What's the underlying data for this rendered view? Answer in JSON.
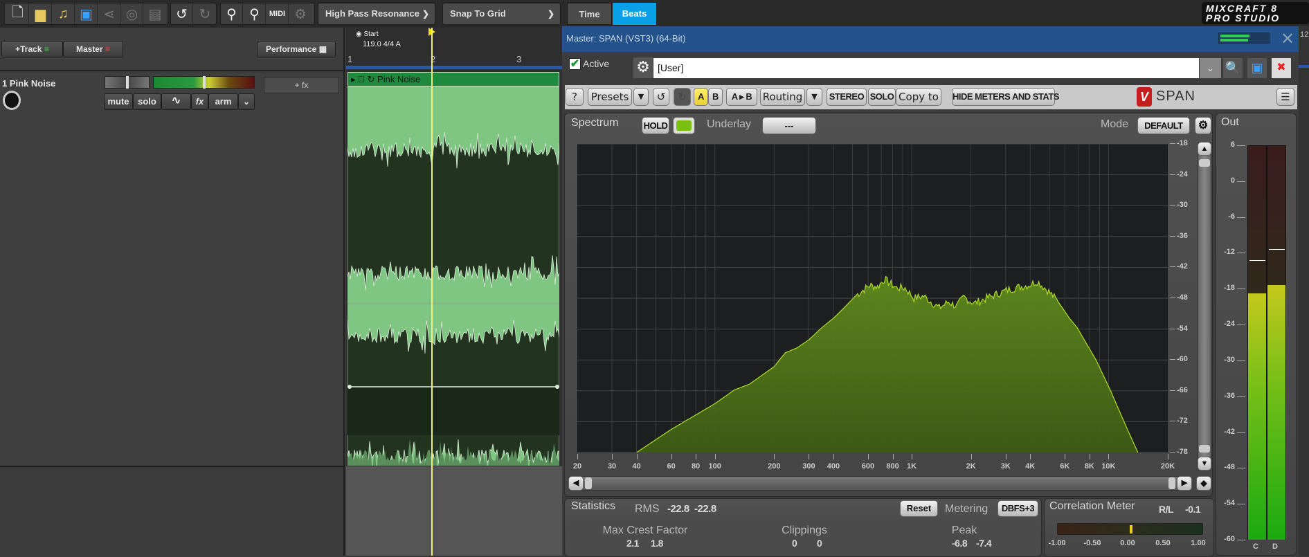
{
  "toolbar": {
    "icons": [
      "new-file-icon",
      "open-folder-icon",
      "open-music-folder-icon",
      "save-icon",
      "share-icon",
      "burn-cd-icon",
      "mixdown-icon",
      "undo-icon",
      "redo-icon",
      "zoom-in-icon",
      "zoom-out-icon",
      "midi-icon",
      "gear-icon"
    ],
    "effect_dropdown": "High Pass Resonance",
    "snap_dropdown": "Snap To Grid",
    "time_label": "Time",
    "beats_label": "Beats",
    "logo_line1": "MIXCRAFT 8",
    "logo_line2": "PRO STUDIO",
    "accent": "#0aa0e8"
  },
  "track_header": {
    "add_track": "+Track",
    "master": "Master",
    "performance": "Performance"
  },
  "tracks": [
    {
      "name": "1 Pink Noise",
      "fx": "+ fx",
      "buttons": [
        "mute",
        "solo",
        "",
        "fx",
        "arm"
      ]
    }
  ],
  "timeline": {
    "start_label": "Start",
    "tempo": "119.0 4/4 A",
    "bars": [
      "1",
      "2",
      "3"
    ],
    "clip_name": "Pink Noise",
    "right_ruler": "12"
  },
  "plugin": {
    "title": "Master: SPAN (VST3) (64-Bit)",
    "active_label": "Active",
    "active": true,
    "preset_value": "[User]",
    "toolbar": {
      "help": "?",
      "presets": "Presets",
      "a": "A",
      "b": "B",
      "ab": "A ▸ B",
      "routing": "Routing",
      "stereo": "STEREO",
      "solo": "SOLO",
      "copy_to": "Copy to",
      "hide": "HIDE METERS AND STATS",
      "brand": "SPAN"
    },
    "spectrum": {
      "tab": "Spectrum",
      "hold": "HOLD",
      "underlay_label": "Underlay",
      "underlay_value": "---",
      "mode_label": "Mode",
      "mode_value": "DEFAULT",
      "db_labels": [
        "-18",
        "-24",
        "-30",
        "-36",
        "-42",
        "-48",
        "-54",
        "-60",
        "-66",
        "-72",
        "-78"
      ],
      "freq_labels": [
        "20",
        "30",
        "40",
        "60",
        "80",
        "100",
        "200",
        "300",
        "400",
        "600",
        "800",
        "1K",
        "2K",
        "3K",
        "4K",
        "6K",
        "8K",
        "10K",
        "20K"
      ],
      "freq_range": [
        20,
        20000
      ],
      "db_range": [
        -78,
        -18
      ],
      "x_scale": "log",
      "fill_color": "#4f6e1a",
      "line_color": "#a8d428",
      "curve": [
        [
          40,
          -78
        ],
        [
          60,
          -73.5
        ],
        [
          100,
          -68.5
        ],
        [
          126,
          -65.8
        ],
        [
          150,
          -64.7
        ],
        [
          200,
          -61.3
        ],
        [
          228,
          -58.6
        ],
        [
          260,
          -57.7
        ],
        [
          300,
          -56.1
        ],
        [
          350,
          -53.7
        ],
        [
          400,
          -51.9
        ],
        [
          447,
          -50.1
        ],
        [
          523,
          -47.4
        ],
        [
          612,
          -45.5
        ],
        [
          670,
          -45.8
        ],
        [
          726,
          -44.3
        ],
        [
          838,
          -46
        ],
        [
          925,
          -46
        ],
        [
          1027,
          -48
        ],
        [
          1150,
          -47.6
        ],
        [
          1380,
          -49.9
        ],
        [
          1540,
          -48.7
        ],
        [
          1690,
          -49.6
        ],
        [
          1840,
          -47.8
        ],
        [
          2080,
          -49
        ],
        [
          2480,
          -47.8
        ],
        [
          3120,
          -46.3
        ],
        [
          3560,
          -45.8
        ],
        [
          3980,
          -45.4
        ],
        [
          4350,
          -44.7
        ],
        [
          4970,
          -46.7
        ],
        [
          5550,
          -48.7
        ],
        [
          6330,
          -51.9
        ],
        [
          6920,
          -53.7
        ],
        [
          8640,
          -60
        ],
        [
          10300,
          -66.2
        ],
        [
          12300,
          -73
        ],
        [
          14100,
          -78
        ]
      ]
    },
    "stats": {
      "tab": "Statistics",
      "rms_label": "RMS",
      "rms": [
        "-22.8",
        "-22.8"
      ],
      "reset": "Reset",
      "metering_label": "Metering",
      "metering_value": "DBFS+3",
      "crest_label": "Max Crest Factor",
      "crest": [
        "2.1",
        "1.8"
      ],
      "clip_label": "Clippings",
      "clips": [
        "0",
        "0"
      ],
      "peak_label": "Peak",
      "peak": [
        "-6.8",
        "-7.4"
      ]
    },
    "correlation": {
      "title": "Correlation Meter",
      "rl_label": "R/L",
      "value": "-0.1",
      "scale": [
        "-1.00",
        "-0.50",
        "0.00",
        "0.50",
        "1.00"
      ],
      "indicator": 0.0
    },
    "out": {
      "tab": "Out",
      "scale": [
        "6",
        "0",
        "-6",
        "-12",
        "-18",
        "-24",
        "-30",
        "-36",
        "-42",
        "-48",
        "-54",
        "-60"
      ],
      "range": [
        -60,
        6
      ],
      "channels": [
        {
          "label": "C",
          "level_db": -18.8,
          "peak_hold_db": -13.2
        },
        {
          "label": "D",
          "level_db": -17.4,
          "peak_hold_db": -11.4
        }
      ]
    }
  }
}
